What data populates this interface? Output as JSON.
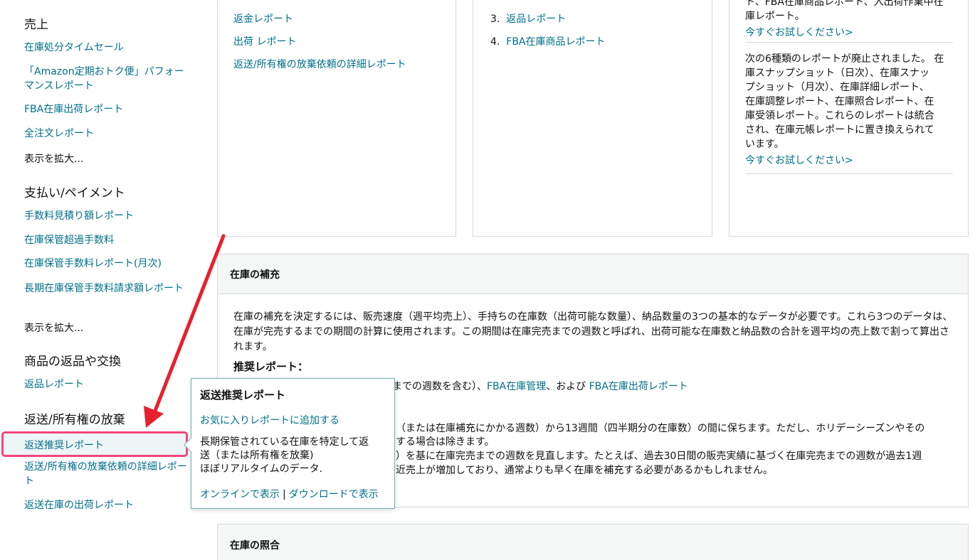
{
  "sidebar": {
    "sales_heading": "売上",
    "sales_items": [
      "在庫処分タイムセール",
      "「Amazon定期おトク便」パフォーマンスレポート",
      "FBA在庫出荷レポート",
      "全注文レポート"
    ],
    "sales_more": "表示を拡大...",
    "payment_heading": "支払い/ペイメント",
    "payment_items": [
      "手数料見積り額レポート",
      "在庫保管超過手数料",
      "在庫保管手数料レポート(月次)",
      "長期在庫保管手数料請求額レポート"
    ],
    "payment_more": "表示を拡大...",
    "returns_heading": "商品の返品や交換",
    "returns_items": [
      "返品レポート"
    ],
    "removal_heading": "返送/所有権の放棄",
    "removal_active": "返送推奨レポート",
    "removal_items": [
      "返送/所有権の放棄依頼の詳細レポート",
      "返送在庫の出荷レポート"
    ]
  },
  "card1": {
    "items": [
      "返金レポート",
      "出荷 レポート",
      "返送/所有権の放棄依頼の詳細レポート"
    ]
  },
  "card2": {
    "items": [
      {
        "num": "3.",
        "label": "返品レポート"
      },
      {
        "num": "4.",
        "label": "FBA在庫商品レポート"
      }
    ]
  },
  "card3": {
    "top_text_1": "ト、FBA在庫商品レポート、入出荷作業中在",
    "top_text_2": "庫レポート。",
    "try_link_1": "今すぐお試しください>",
    "note_lines": [
      "次の6種類のレポートが廃止されました。 在",
      "庫スナップショット（日次）、在庫スナッ",
      "プショット（月次）、在庫詳細レポート、",
      "在庫調整レポート、在庫照合レポート、在",
      "庫受領レポート。これらのレポートは統合",
      "され、在庫元帳レポートに置き換えられて",
      "います。"
    ],
    "try_link_2": "今すぐお試しください>"
  },
  "replenish": {
    "title": "在庫の補充",
    "intro": "在庫の補充を決定するには、販売速度（週平均売上）、手持ちの在庫数（出荷可能な数量）、納品数量の3つの基本的なデータが必要です。これら3つのデータは、在庫が完売するまでの期間の計算に使用されます。この期間は在庫完売までの週数と呼ばれ、出荷可能な在庫数と納品数の合計を週平均の売上数で割って算出されます。",
    "rec_title": "推奨レポート：",
    "rec_frag": "までの週数を含む）、",
    "rec_link_1": "FBA在庫管理",
    "rec_and": "、および ",
    "rec_link_2": "FBA在庫出荷レポート",
    "frag_1": "（または在庫補充にかかる週数）から13週間（四半期分の在庫数）の間に保ちます。ただし、ホリデーシーズンやその",
    "frag_2": "する場合は除きます。",
    "frag_3": "）を基に在庫完売までの週数を見直します。たとえば、過去30日間の販売実績に基づく在庫完売までの週数が過去1週",
    "frag_4": "近売上が増加しており、通常よりも早く在庫を補充する必要があるかもしれません。"
  },
  "reconcile": {
    "title": "在庫の照合"
  },
  "popover": {
    "title": "返送推奨レポート",
    "fav": "お気に入りレポートに追加する",
    "desc_1": "長期保管されている在庫を特定して返",
    "desc_2": "送（または所有権を放棄)",
    "desc_3": "ほぼリアルタイムのデータ.",
    "online": "オンラインで表示",
    "sep": "|",
    "download": "ダウンロードで表示"
  },
  "colors": {
    "link": "#00708a",
    "highlight": "#f2467a",
    "arrow": "#e8202e"
  }
}
